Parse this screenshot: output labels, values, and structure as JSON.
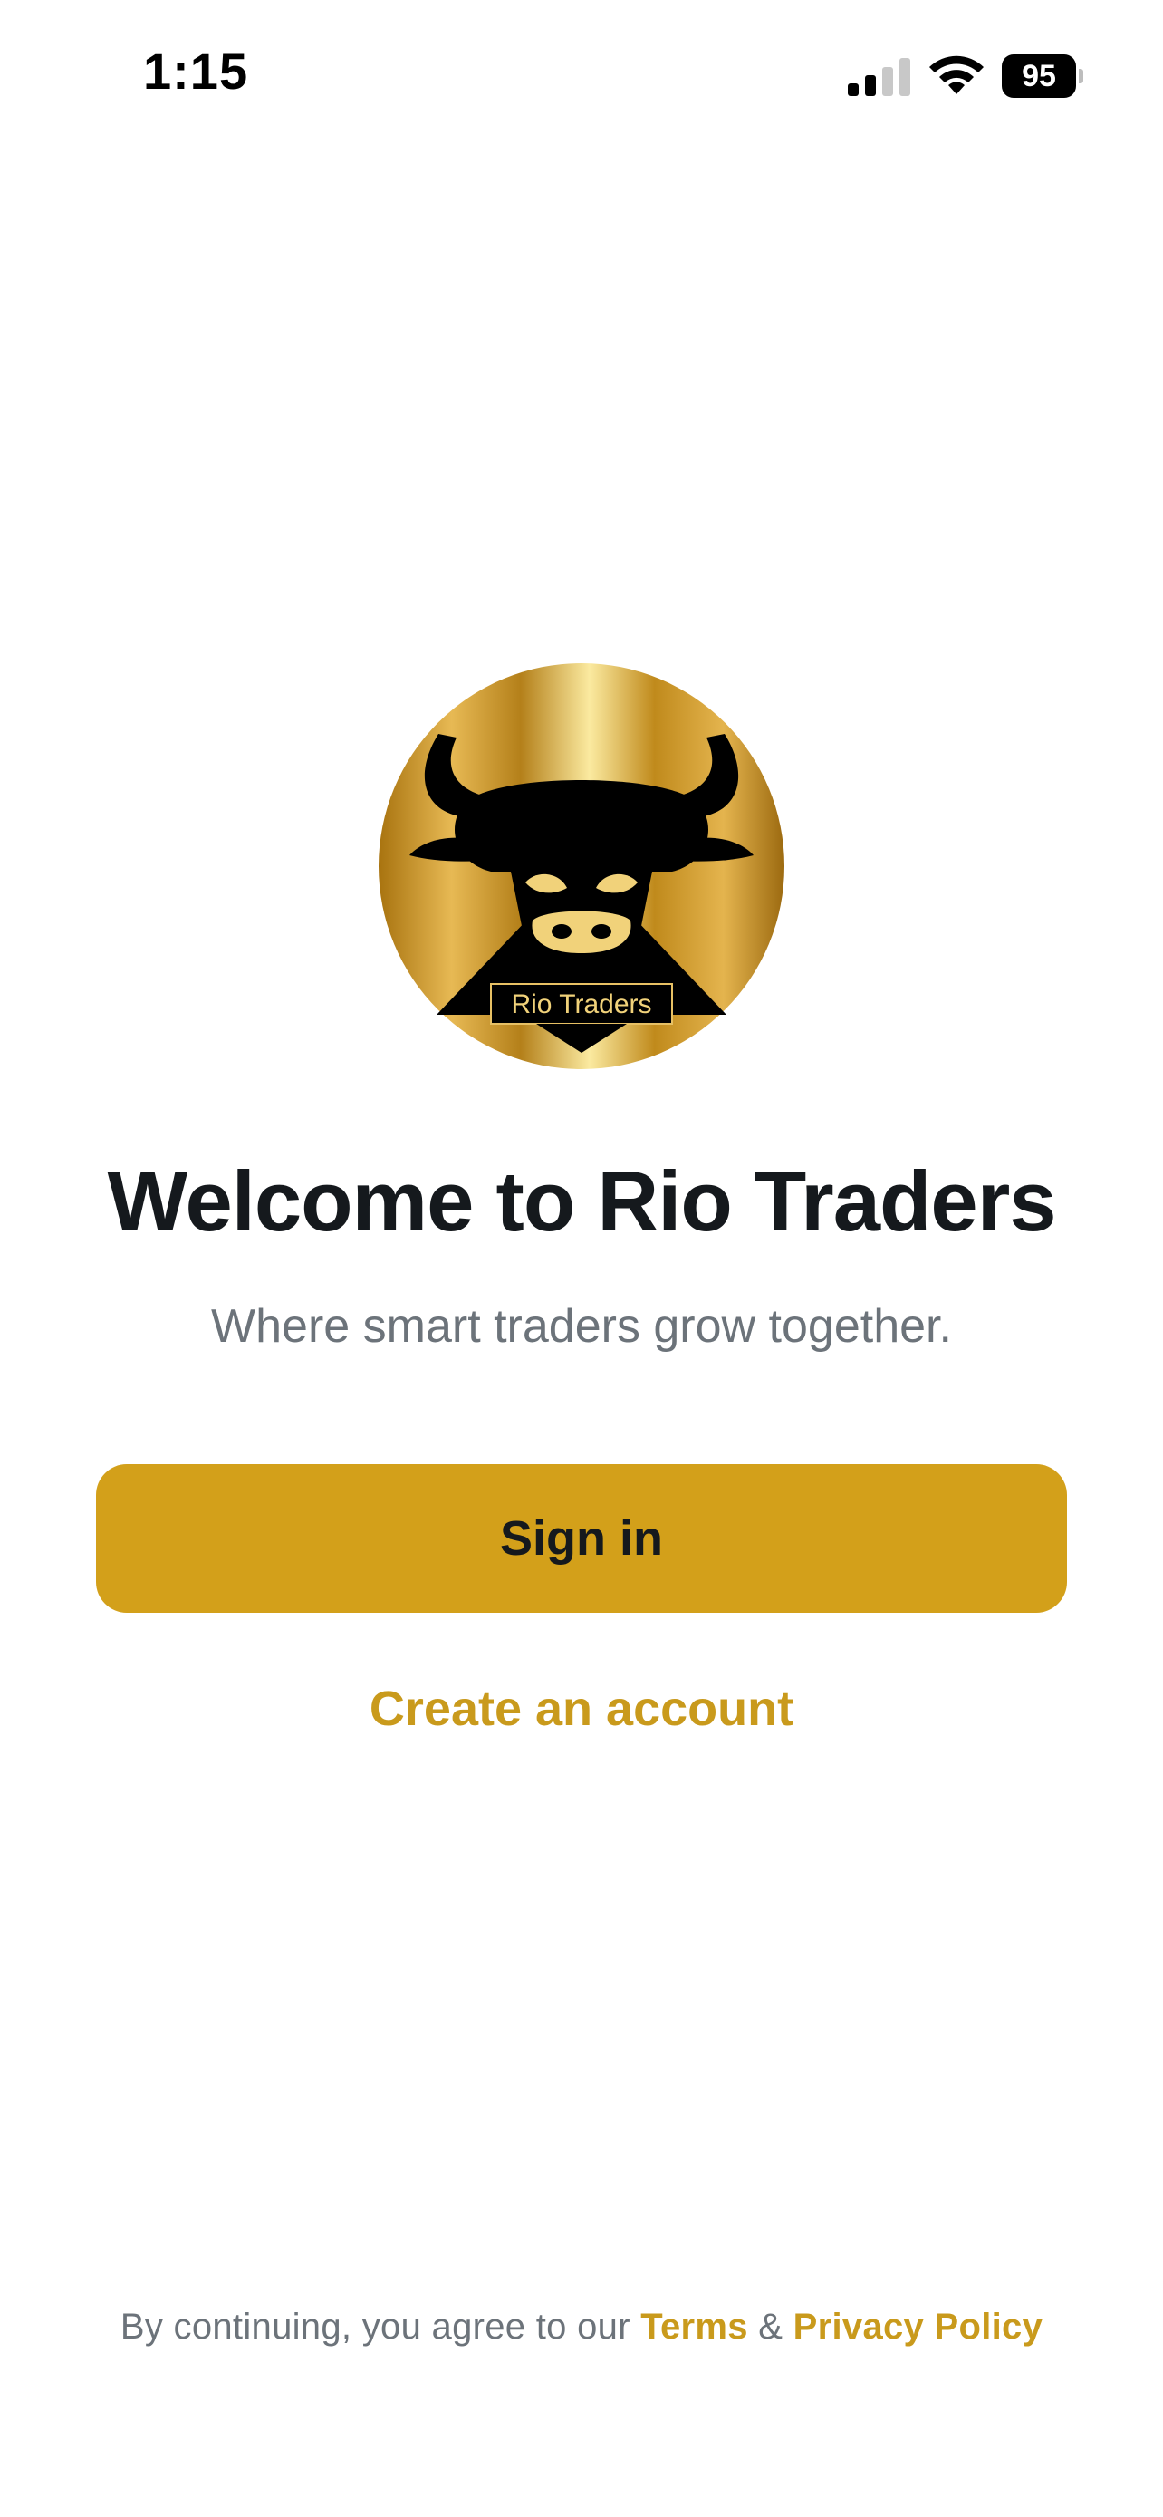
{
  "status_bar": {
    "time": "1:15",
    "battery_level": "95",
    "icons": [
      "signal-icon",
      "wifi-icon",
      "battery-icon"
    ]
  },
  "logo": {
    "text": "Rio Traders",
    "icon": "bull-logo"
  },
  "welcome": {
    "title": "Welcome to Rio Traders",
    "subtitle": "Where smart traders grow together."
  },
  "actions": {
    "sign_in_label": "Sign in",
    "create_account_label": "Create an account"
  },
  "legal": {
    "prefix": "By continuing, you agree to our ",
    "terms_label": "Terms",
    "connector": " & ",
    "privacy_label": "Privacy Policy"
  },
  "colors": {
    "accent": "#d3a01a",
    "link": "#c99a1c",
    "title": "#15191d",
    "muted": "#6c737a"
  }
}
